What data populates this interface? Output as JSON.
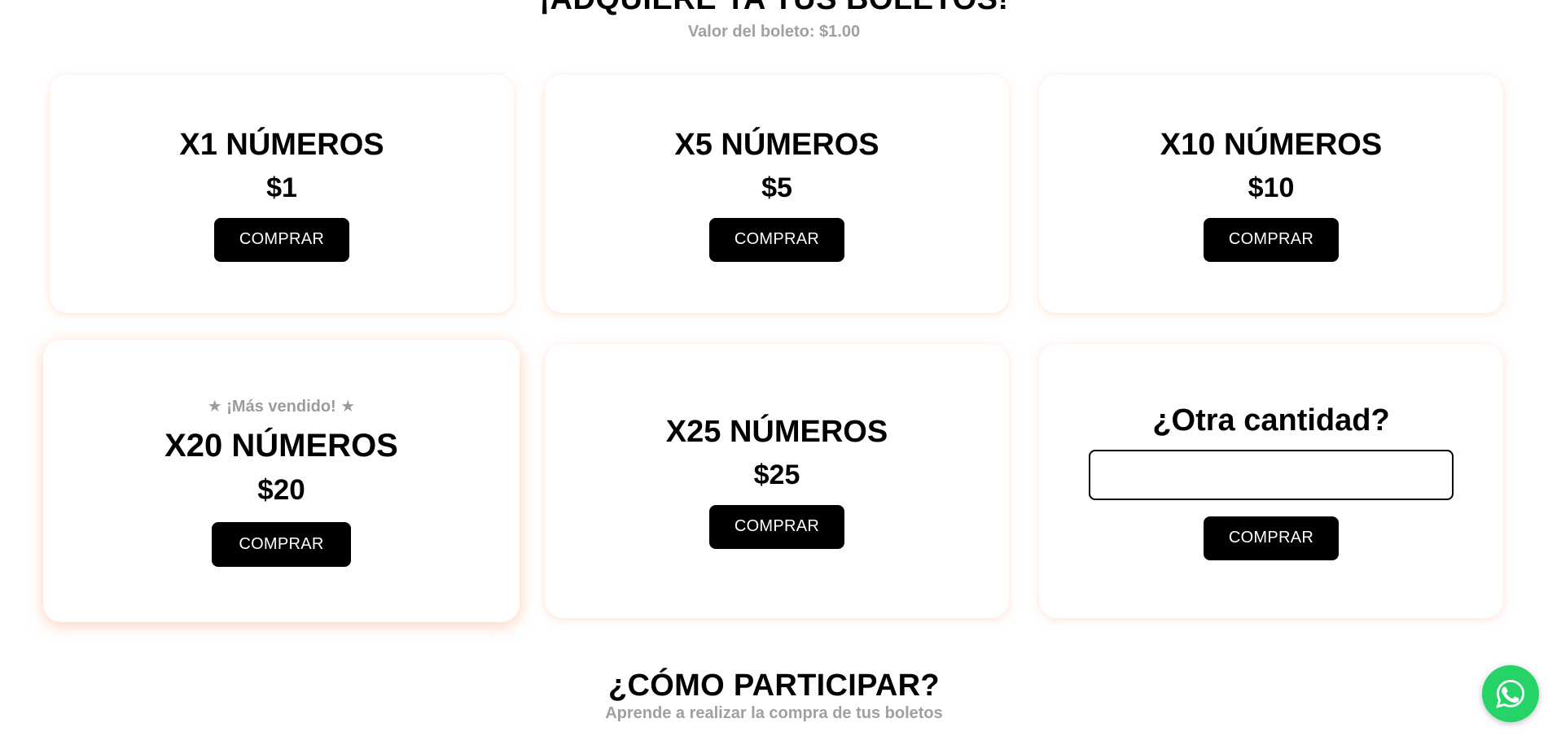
{
  "header": {
    "title": "¡ADQUIERE YA TUS BOLETOS!",
    "subtitle": "Valor del boleto: $1.00"
  },
  "packages": [
    {
      "title": "X1 NÚMEROS",
      "price": "$1",
      "button_label": "COMPRAR"
    },
    {
      "title": "X5 NÚMEROS",
      "price": "$5",
      "button_label": "COMPRAR"
    },
    {
      "title": "X10 NÚMEROS",
      "price": "$10",
      "button_label": "COMPRAR"
    },
    {
      "badge": "★ ¡Más vendido! ★",
      "title": "X20 NÚMEROS",
      "price": "$20",
      "button_label": "COMPRAR"
    },
    {
      "title": "X25 NÚMEROS",
      "price": "$25",
      "button_label": "COMPRAR"
    }
  ],
  "custom_quantity": {
    "title": "¿Otra cantidad?",
    "input_value": "",
    "button_label": "COMPRAR"
  },
  "how_to": {
    "title": "¿CÓMO PARTICIPAR?",
    "subtitle": "Aprende a realizar la compra de tus boletos"
  },
  "floating": {
    "icon": "whatsapp-icon",
    "color": "#25d366"
  },
  "colors": {
    "button_bg": "#000000",
    "button_text": "#ffffff",
    "muted_text": "#a0a0a0",
    "card_glow": "#ffaa82"
  }
}
